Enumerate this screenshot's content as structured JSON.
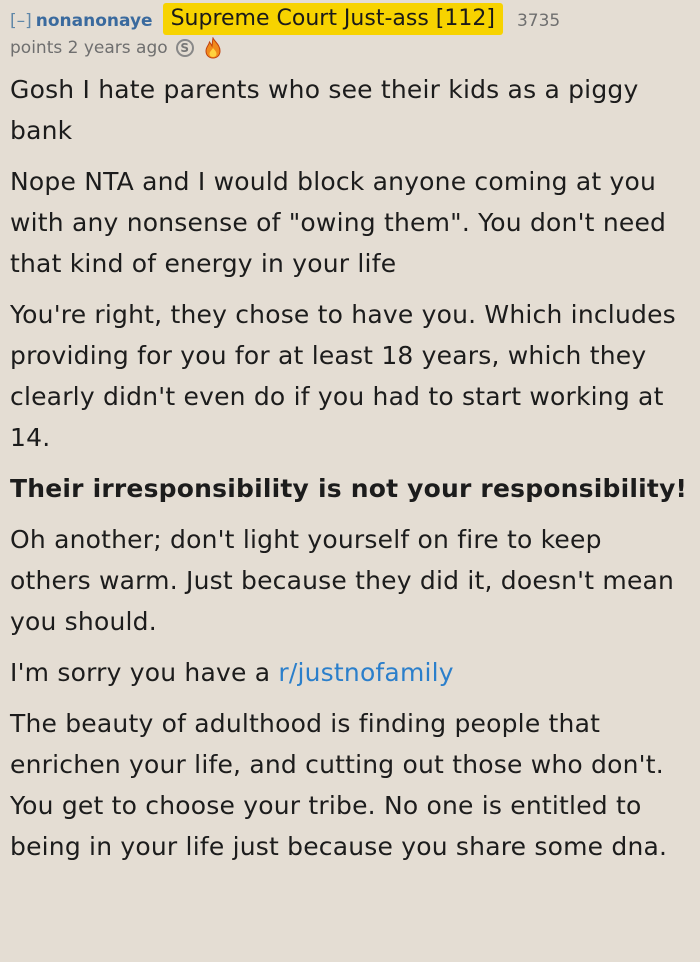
{
  "comment": {
    "collapse_label": "[–]",
    "author": "nonanonaye",
    "flair": "Supreme Court Just-ass [112]",
    "score_number": "3735",
    "score_rest": "points 2 years ago",
    "awards": [
      "silver-award-icon",
      "fire-award-icon"
    ],
    "paragraphs": [
      "Gosh I hate parents who see their kids as a piggy bank",
      "Nope NTA and I would block anyone coming at you with any nonsense of \"owing them\". You don't need that kind of energy in your life",
      "You're right, they chose to have you. Which includes providing for you for at least 18 years, which they clearly didn't even do if you had to start working at 14.",
      "Their irresponsibility is not your responsibility!",
      "Oh another; don't light yourself on fire to keep others warm. Just because they did it, doesn't mean you should."
    ],
    "sorry_prefix": "I'm sorry you have a ",
    "sorry_link": "r/justnofamily",
    "closing": "The beauty of adulthood is finding people that enrichen your life, and cutting out those who don't. You get to choose your tribe. No one is entitled to being in your life just because you share some dna."
  },
  "colors": {
    "background": "#e4ddd3",
    "flair_bg": "#f7d300",
    "author": "#3a6a9e",
    "link": "#2b7fcb"
  }
}
